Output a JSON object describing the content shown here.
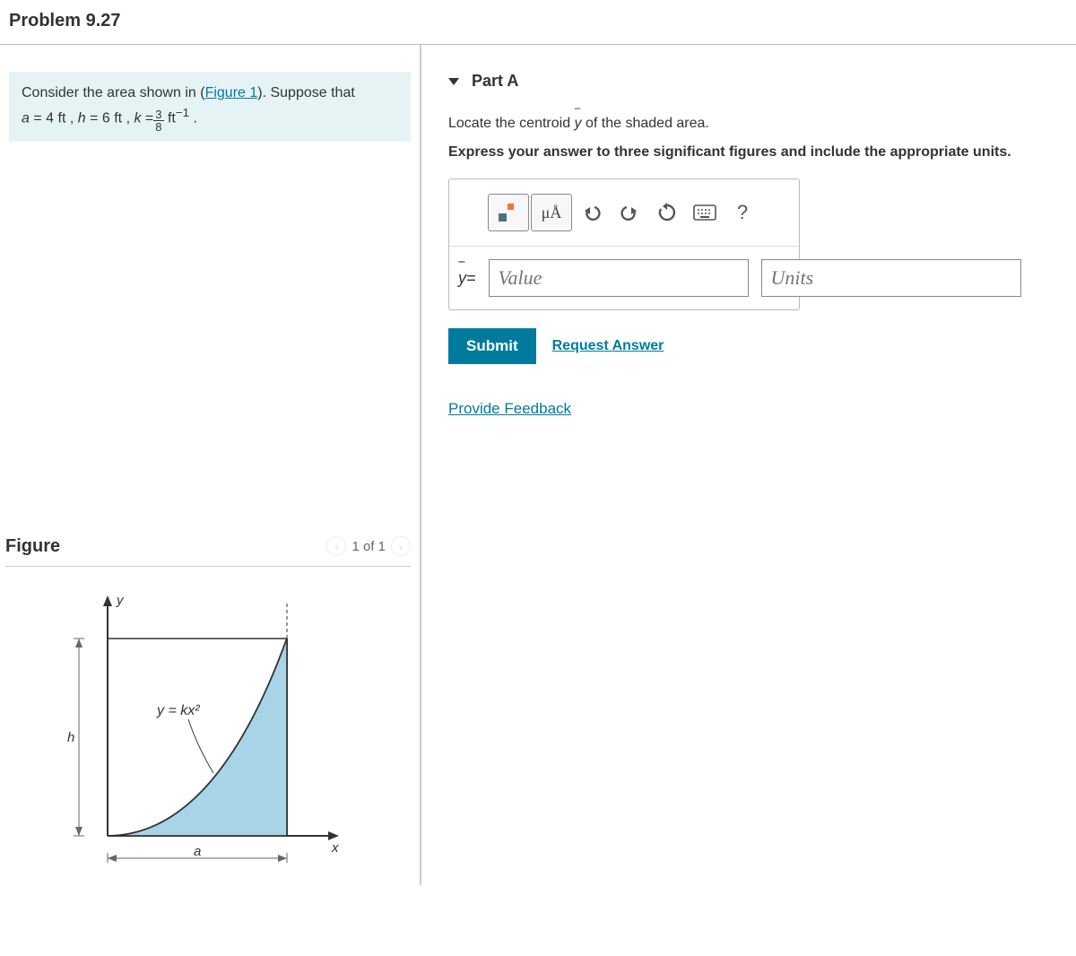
{
  "problem_title": "Problem 9.27",
  "info": {
    "line_prefix": "Consider the area shown in (",
    "figure_link": "Figure 1",
    "line_suffix": "). Suppose that",
    "a_label": "a",
    "a_val": "= 4  ft",
    "h_label": "h",
    "h_val": "= 6  ft",
    "k_label": "k",
    "k_equals": "=",
    "k_frac_num": "3",
    "k_frac_den": "8",
    "k_unit": "ft",
    "k_exp": "−1",
    "period": " ."
  },
  "figure": {
    "title": "Figure",
    "nav_label": "1 of 1",
    "eq_label": "y = kx²",
    "y_axis": "y",
    "x_axis": "x",
    "h_label": "h",
    "a_label": "a"
  },
  "part": {
    "title": "Part A",
    "prompt1_pre": "Locate the centroid ",
    "prompt1_var": "y",
    "prompt1_post": " of the shaded area.",
    "prompt2": "Express your answer to three significant figures and include the appropriate units.",
    "units_tool": "μÅ",
    "help_tool": "?",
    "ybar_label": "y",
    "equals": " =",
    "value_placeholder": "Value",
    "units_placeholder": "Units",
    "submit": "Submit",
    "request_answer": "Request Answer",
    "feedback": "Provide Feedback"
  }
}
